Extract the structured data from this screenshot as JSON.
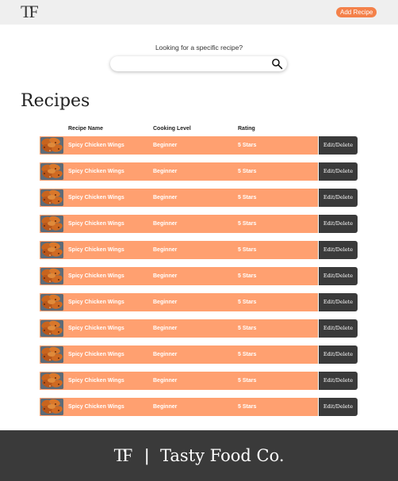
{
  "header": {
    "logo": "TF",
    "add_recipe_label": "Add Recipe"
  },
  "search": {
    "prompt": "Looking for a specific recipe?",
    "value": "",
    "placeholder": ""
  },
  "main": {
    "title": "Recipes",
    "columns": [
      "Recipe Name",
      "Cooking Level",
      "Rating"
    ],
    "rows": [
      {
        "name": "Spicy Chicken Wings",
        "level": "Beginner",
        "rating": "5 Stars",
        "action": "Edit/Delete"
      },
      {
        "name": "Spicy Chicken Wings",
        "level": "Beginner",
        "rating": "5 Stars",
        "action": "Edit/Delete"
      },
      {
        "name": "Spicy Chicken Wings",
        "level": "Beginner",
        "rating": "5 Stars",
        "action": "Edit/Delete"
      },
      {
        "name": "Spicy Chicken Wings",
        "level": "Beginner",
        "rating": "5 Stars",
        "action": "Edit/Delete"
      },
      {
        "name": "Spicy Chicken Wings",
        "level": "Beginner",
        "rating": "5 Stars",
        "action": "Edit/Delete"
      },
      {
        "name": "Spicy Chicken Wings",
        "level": "Beginner",
        "rating": "5 Stars",
        "action": "Edit/Delete"
      },
      {
        "name": "Spicy Chicken Wings",
        "level": "Beginner",
        "rating": "5 Stars",
        "action": "Edit/Delete"
      },
      {
        "name": "Spicy Chicken Wings",
        "level": "Beginner",
        "rating": "5 Stars",
        "action": "Edit/Delete"
      },
      {
        "name": "Spicy Chicken Wings",
        "level": "Beginner",
        "rating": "5 Stars",
        "action": "Edit/Delete"
      },
      {
        "name": "Spicy Chicken Wings",
        "level": "Beginner",
        "rating": "5 Stars",
        "action": "Edit/Delete"
      },
      {
        "name": "Spicy Chicken Wings",
        "level": "Beginner",
        "rating": "5 Stars",
        "action": "Edit/Delete"
      }
    ]
  },
  "footer": {
    "logo": "TF",
    "separator": "|",
    "brand_name": "Tasty Food Co."
  },
  "colors": {
    "accent": "#f4814a",
    "row_bg": "#ffa070",
    "dark": "#3a3a3a",
    "header_bg": "#efefef"
  },
  "icons": {
    "search": "magnifier-icon",
    "thumbnail": "chicken-wings-photo"
  }
}
